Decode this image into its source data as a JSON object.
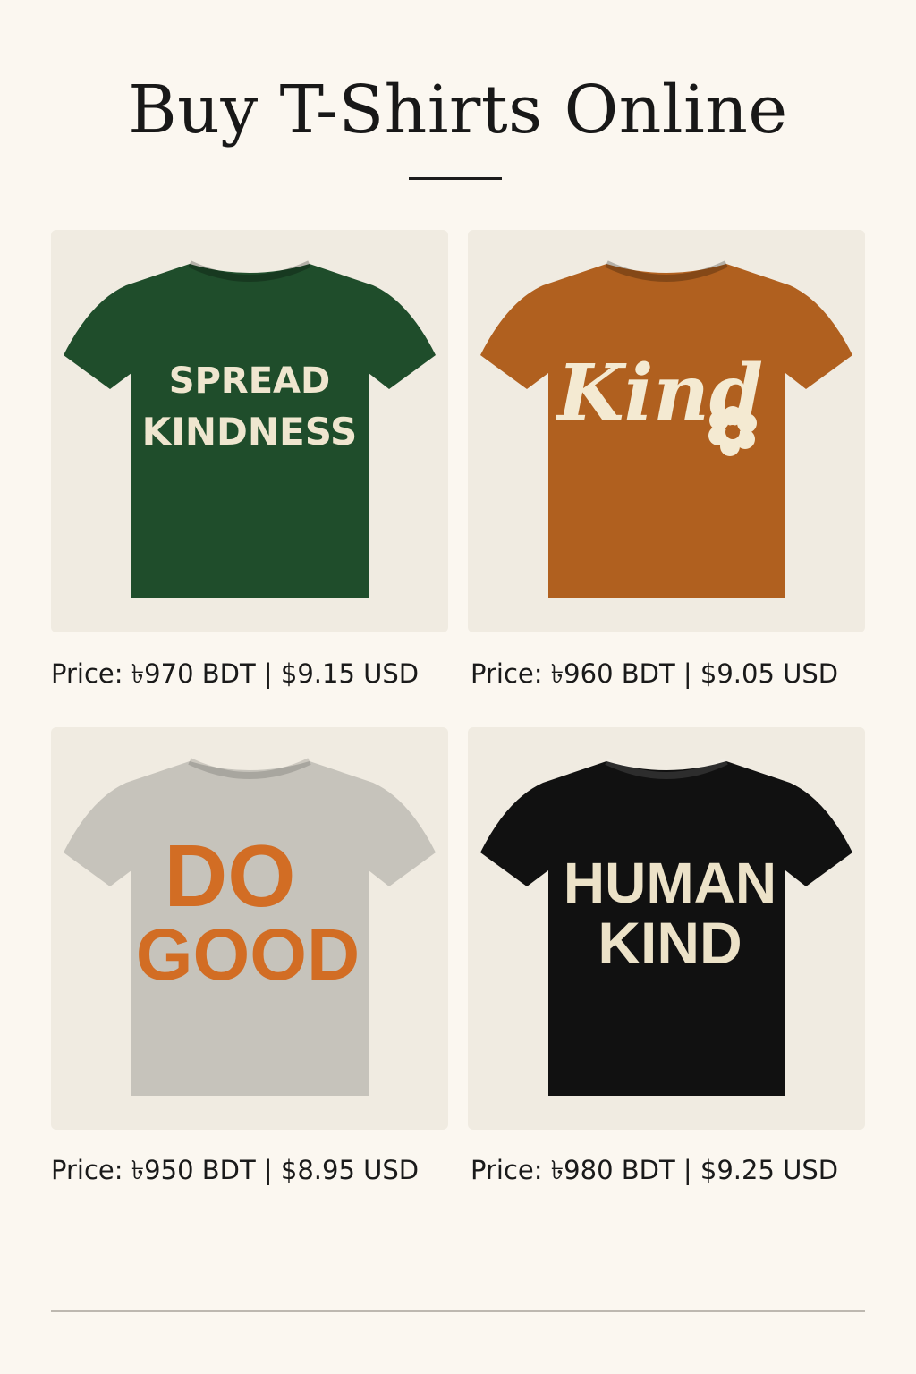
{
  "page": {
    "title": "Buy T-Shirts Online"
  },
  "products": [
    {
      "shirt_color": "#1f4d2b",
      "print_color": "#efe6cf",
      "print_lines": [
        "SPREAD",
        "KINDNESS"
      ],
      "price": "Price: ৳970 BDT | $9.15 USD"
    },
    {
      "shirt_color": "#b0601f",
      "print_color": "#f4ead2",
      "print_lines": [
        "Kind"
      ],
      "price": "Price: ৳960 BDT | $9.05 USD"
    },
    {
      "shirt_color": "#c6c3bb",
      "print_color": "#d26d24",
      "print_lines": [
        "DO",
        "GOOD"
      ],
      "price": "Price: ৳950 BDT | $8.95 USD"
    },
    {
      "shirt_color": "#111111",
      "print_color": "#ece2c8",
      "print_lines": [
        "HUMAN",
        "KIND"
      ],
      "price": "Price: ৳980 BDT | $9.25 USD"
    }
  ]
}
